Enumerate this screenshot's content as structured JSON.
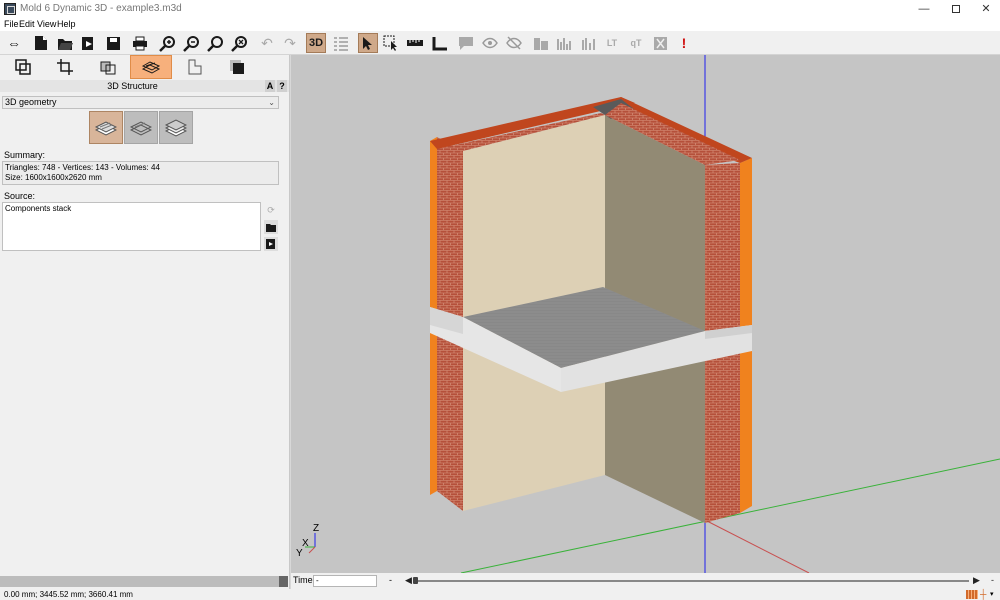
{
  "window": {
    "title": "Mold 6 Dynamic 3D - example3.m3d",
    "icon": "app-icon",
    "controls": {
      "minimize": "—",
      "close": "✕"
    }
  },
  "menu": [
    "File",
    "Edit",
    "View",
    "Help"
  ],
  "toolbar": {
    "mode_3d_label": "3D",
    "active_tools": [
      "3d-mode-button",
      "select-arrow-button"
    ],
    "items": [
      "toggle-panel-icon",
      "new-file-icon",
      "open-file-icon",
      "import-icon",
      "save-icon",
      "print-icon",
      "zoom-in-icon",
      "zoom-out-icon",
      "zoom-fit-icon",
      "zoom-window-icon",
      "undo-icon",
      "redo-icon",
      "3d-mode-icon",
      "list-icon",
      "select-arrow-icon",
      "select-box-icon",
      "measure-icon",
      "angle-icon",
      "comment-icon",
      "eye-icon",
      "hide-icon",
      "chart-bar-icon",
      "chart-bars-icon",
      "chart-stack-icon",
      "chart-lt-icon",
      "chart-qt-icon",
      "compare-icon",
      "warning-icon"
    ],
    "lt_label": "LT",
    "qt_label": "qT",
    "warning_label": "!"
  },
  "left_panel": {
    "tabs": [
      "layers-tab",
      "crop-tab",
      "bricks-tab",
      "3d-structure-tab",
      "sheet-tab",
      "gradient-tab"
    ],
    "active_tab": "3d-structure-tab",
    "header": "3D Structure",
    "header_buttons": [
      "A",
      "?"
    ],
    "geometry_select": {
      "value": "3D geometry",
      "chevron": "⌄"
    },
    "view_buttons_active": 0,
    "summary_label": "Summary:",
    "summary_line1": "Triangles: 748 - Vertices: 143 - Volumes: 44",
    "summary_line2": "Size: 1600x1600x2620 mm",
    "source_label": "Source:",
    "source_text": "Components stack"
  },
  "viewport": {
    "background": "#c5c5c5",
    "axis_labels": {
      "z": "Z",
      "x": "X",
      "y": "Y"
    },
    "colors": {
      "insulation": "#f0821e",
      "brick": "#b24a36",
      "plaster_left": "#ddd0b5",
      "plaster_right": "#928a74",
      "slab_top": "#8a8a8a",
      "slab_side": "#e4e4e4",
      "axis_blue": "#1e1ef0",
      "axis_green": "#39b239",
      "axis_red": "#c85050"
    }
  },
  "timebar": {
    "label": "Time:",
    "value": "-",
    "dash": "-"
  },
  "statusbar": {
    "coordinates": "0.00 mm; 3445.52 mm; 3660.41 mm"
  }
}
